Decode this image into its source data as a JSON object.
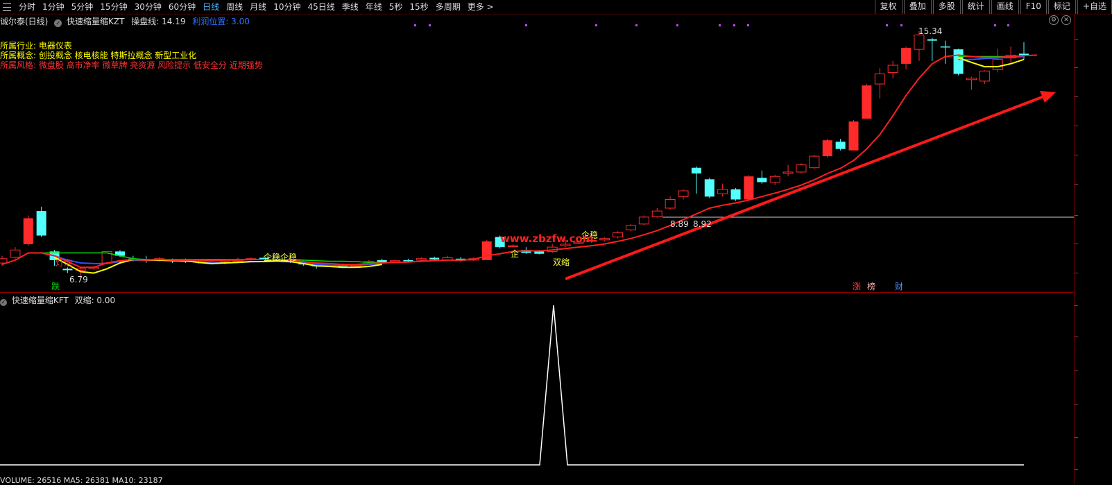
{
  "toolbar": {
    "periods": [
      "分时",
      "1分钟",
      "5分钟",
      "15分钟",
      "30分钟",
      "60分钟",
      "日线",
      "周线",
      "月线",
      "10分钟",
      "45日线",
      "季线",
      "年线",
      "5秒",
      "15秒",
      "多周期",
      "更多 >"
    ],
    "active_index": 6,
    "right_buttons": [
      "复权",
      "叠加",
      "多股",
      "统计",
      "画线",
      "F10",
      "标记",
      "+自选"
    ]
  },
  "main_panel": {
    "title": "诚尔泰(日线)",
    "indicator_name": "快速缩量缩KZT",
    "line1_label": "操盘线: 14.19",
    "line2_label": "利润位置: 3.00",
    "industry": "所属行业: 电器仪表",
    "concepts": "所属概念: 创投概念 核电核能 特斯拉概念 新型工业化",
    "style": "所属风格: 微盘股 高市净率 微草牌 亮资源 风险提示 低安全分 近期强势",
    "high_label": "15.34",
    "low_label": "6.79",
    "mark_889": "8.89",
    "mark_892": "8.92",
    "watermark": "www.zbzfw.com",
    "signal_dengpao": "灯泡",
    "signal_die": "跌",
    "signal_qiwen1": "企稳企稳",
    "signal_qiwen2": "企稳",
    "signal_qi": "企",
    "signal_shuangsuo": "双缩",
    "tag_zhang": "涨",
    "tag_bang": "榜",
    "tag_cai": "财",
    "colors": {
      "up": "#ff2a2a",
      "down": "#54ffff",
      "ma_red": "#ff2020",
      "ma_yellow": "#ffff00",
      "ma_green": "#00e000",
      "ma_blue": "#3050ff",
      "background": "#000000"
    }
  },
  "sub_panel": {
    "indicator_name": "快速缩量缩KFT",
    "value_label": "双缩: 0.00"
  },
  "footer": {
    "volume_text": "VOLUME: 26516  MA5: 26381  MA10: 23187"
  },
  "chart_data": {
    "type": "candlestick",
    "title": "诚尔泰(日线)",
    "candles": [
      {
        "o": 7.3,
        "c": 7.45,
        "h": 7.55,
        "l": 7.2,
        "dir": "up"
      },
      {
        "o": 7.5,
        "c": 7.75,
        "h": 7.85,
        "l": 7.45,
        "dir": "up"
      },
      {
        "o": 7.95,
        "c": 8.85,
        "h": 8.95,
        "l": 7.9,
        "dir": "up"
      },
      {
        "o": 9.1,
        "c": 8.25,
        "h": 9.25,
        "l": 8.2,
        "dir": "down"
      },
      {
        "o": 7.7,
        "c": 7.4,
        "h": 7.75,
        "l": 7.2,
        "dir": "down"
      },
      {
        "o": 7.1,
        "c": 7.05,
        "h": 7.15,
        "l": 6.95,
        "dir": "down"
      },
      {
        "o": 7.05,
        "c": 7.1,
        "h": 7.15,
        "l": 6.79,
        "dir": "up"
      },
      {
        "o": 7.1,
        "c": 7.15,
        "h": 7.2,
        "l": 7.05,
        "dir": "up"
      },
      {
        "o": 7.3,
        "c": 7.7,
        "h": 7.72,
        "l": 7.25,
        "dir": "up"
      },
      {
        "o": 7.7,
        "c": 7.55,
        "h": 7.75,
        "l": 7.5,
        "dir": "down"
      },
      {
        "o": 7.45,
        "c": 7.4,
        "h": 7.55,
        "l": 7.35,
        "dir": "down"
      },
      {
        "o": 7.42,
        "c": 7.4,
        "h": 7.55,
        "l": 7.3,
        "dir": "down"
      },
      {
        "o": 7.38,
        "c": 7.45,
        "h": 7.5,
        "l": 7.35,
        "dir": "up"
      },
      {
        "o": 7.4,
        "c": 7.38,
        "h": 7.45,
        "l": 7.3,
        "dir": "down"
      },
      {
        "o": 7.38,
        "c": 7.38,
        "h": 7.45,
        "l": 7.3,
        "dir": "down"
      },
      {
        "o": 7.36,
        "c": 7.32,
        "h": 7.4,
        "l": 7.28,
        "dir": "down"
      },
      {
        "o": 7.3,
        "c": 7.28,
        "h": 7.35,
        "l": 7.25,
        "dir": "down"
      },
      {
        "o": 7.3,
        "c": 7.35,
        "h": 7.4,
        "l": 7.25,
        "dir": "up"
      },
      {
        "o": 7.38,
        "c": 7.4,
        "h": 7.48,
        "l": 7.35,
        "dir": "up"
      },
      {
        "o": 7.42,
        "c": 7.45,
        "h": 7.5,
        "l": 7.38,
        "dir": "up"
      },
      {
        "o": 7.48,
        "c": 7.42,
        "h": 7.52,
        "l": 7.38,
        "dir": "down"
      },
      {
        "o": 7.45,
        "c": 7.4,
        "h": 7.55,
        "l": 7.35,
        "dir": "down"
      },
      {
        "o": 7.4,
        "c": 7.38,
        "h": 7.45,
        "l": 7.3,
        "dir": "down"
      },
      {
        "o": 7.35,
        "c": 7.25,
        "h": 7.38,
        "l": 7.2,
        "dir": "down"
      },
      {
        "o": 7.22,
        "c": 7.2,
        "h": 7.28,
        "l": 7.1,
        "dir": "down"
      },
      {
        "o": 7.2,
        "c": 7.22,
        "h": 7.28,
        "l": 7.15,
        "dir": "up"
      },
      {
        "o": 7.22,
        "c": 7.18,
        "h": 7.28,
        "l": 7.12,
        "dir": "down"
      },
      {
        "o": 7.2,
        "c": 7.22,
        "h": 7.25,
        "l": 7.15,
        "dir": "up"
      },
      {
        "o": 7.25,
        "c": 7.35,
        "h": 7.4,
        "l": 7.22,
        "dir": "up"
      },
      {
        "o": 7.4,
        "c": 7.32,
        "h": 7.45,
        "l": 7.3,
        "dir": "down"
      },
      {
        "o": 7.35,
        "c": 7.38,
        "h": 7.42,
        "l": 7.3,
        "dir": "up"
      },
      {
        "o": 7.4,
        "c": 7.36,
        "h": 7.45,
        "l": 7.32,
        "dir": "down"
      },
      {
        "o": 7.4,
        "c": 7.45,
        "h": 7.5,
        "l": 7.35,
        "dir": "up"
      },
      {
        "o": 7.48,
        "c": 7.42,
        "h": 7.52,
        "l": 7.38,
        "dir": "down"
      },
      {
        "o": 7.4,
        "c": 7.48,
        "h": 7.55,
        "l": 7.38,
        "dir": "up"
      },
      {
        "o": 7.45,
        "c": 7.38,
        "h": 7.5,
        "l": 7.35,
        "dir": "down"
      },
      {
        "o": 7.4,
        "c": 7.45,
        "h": 7.5,
        "l": 7.38,
        "dir": "up"
      },
      {
        "o": 7.4,
        "c": 8.05,
        "h": 8.1,
        "l": 7.4,
        "dir": "up"
      },
      {
        "o": 8.2,
        "c": 7.85,
        "h": 8.25,
        "l": 7.8,
        "dir": "down"
      },
      {
        "o": 7.88,
        "c": 7.9,
        "h": 7.95,
        "l": 7.85,
        "dir": "up"
      },
      {
        "o": 7.75,
        "c": 7.65,
        "h": 7.85,
        "l": 7.62,
        "dir": "down"
      },
      {
        "o": 7.7,
        "c": 7.62,
        "h": 7.75,
        "l": 7.6,
        "dir": "down"
      },
      {
        "o": 7.7,
        "c": 7.85,
        "h": 7.95,
        "l": 7.65,
        "dir": "up"
      },
      {
        "o": 7.9,
        "c": 7.95,
        "h": 8.1,
        "l": 7.85,
        "dir": "up"
      },
      {
        "o": 8.0,
        "c": 8.02,
        "h": 8.08,
        "l": 7.95,
        "dir": "up"
      },
      {
        "o": 8.05,
        "c": 8.08,
        "h": 8.12,
        "l": 8.0,
        "dir": "up"
      },
      {
        "o": 8.1,
        "c": 8.15,
        "h": 8.2,
        "l": 8.05,
        "dir": "up"
      },
      {
        "o": 8.2,
        "c": 8.35,
        "h": 8.4,
        "l": 8.15,
        "dir": "up"
      },
      {
        "o": 8.45,
        "c": 8.6,
        "h": 8.65,
        "l": 8.4,
        "dir": "up"
      },
      {
        "o": 8.65,
        "c": 8.89,
        "h": 8.95,
        "l": 8.6,
        "dir": "up"
      },
      {
        "o": 8.9,
        "c": 9.1,
        "h": 9.2,
        "l": 8.85,
        "dir": "up"
      },
      {
        "o": 9.2,
        "c": 9.5,
        "h": 9.6,
        "l": 9.15,
        "dir": "up"
      },
      {
        "o": 9.6,
        "c": 9.8,
        "h": 9.85,
        "l": 9.5,
        "dir": "up"
      },
      {
        "o": 10.6,
        "c": 10.4,
        "h": 10.65,
        "l": 9.7,
        "dir": "down"
      },
      {
        "o": 10.2,
        "c": 9.6,
        "h": 10.25,
        "l": 9.55,
        "dir": "down"
      },
      {
        "o": 9.7,
        "c": 9.85,
        "h": 10.05,
        "l": 9.6,
        "dir": "up"
      },
      {
        "o": 9.85,
        "c": 9.5,
        "h": 9.9,
        "l": 9.45,
        "dir": "down"
      },
      {
        "o": 9.5,
        "c": 10.3,
        "h": 10.35,
        "l": 9.5,
        "dir": "up"
      },
      {
        "o": 10.25,
        "c": 10.1,
        "h": 10.5,
        "l": 10.05,
        "dir": "down"
      },
      {
        "o": 10.1,
        "c": 10.3,
        "h": 10.35,
        "l": 10.0,
        "dir": "up"
      },
      {
        "o": 10.4,
        "c": 10.45,
        "h": 10.7,
        "l": 10.3,
        "dir": "up"
      },
      {
        "o": 10.45,
        "c": 10.7,
        "h": 10.75,
        "l": 10.4,
        "dir": "up"
      },
      {
        "o": 10.6,
        "c": 11.0,
        "h": 11.05,
        "l": 10.55,
        "dir": "up"
      },
      {
        "o": 11.0,
        "c": 11.55,
        "h": 11.6,
        "l": 10.95,
        "dir": "up"
      },
      {
        "o": 11.5,
        "c": 11.25,
        "h": 11.6,
        "l": 11.2,
        "dir": "down"
      },
      {
        "o": 11.2,
        "c": 12.2,
        "h": 12.25,
        "l": 11.2,
        "dir": "up"
      },
      {
        "o": 12.3,
        "c": 13.45,
        "h": 13.5,
        "l": 12.3,
        "dir": "up"
      },
      {
        "o": 13.5,
        "c": 13.85,
        "h": 14.05,
        "l": 13.0,
        "dir": "up"
      },
      {
        "o": 13.9,
        "c": 14.15,
        "h": 14.3,
        "l": 13.7,
        "dir": "up"
      },
      {
        "o": 14.2,
        "c": 14.75,
        "h": 14.8,
        "l": 14.0,
        "dir": "up"
      },
      {
        "o": 14.7,
        "c": 15.2,
        "h": 15.34,
        "l": 14.3,
        "dir": "up"
      },
      {
        "o": 15.05,
        "c": 15.0,
        "h": 15.1,
        "l": 14.3,
        "dir": "down"
      },
      {
        "o": 14.8,
        "c": 14.8,
        "h": 15.0,
        "l": 14.2,
        "dir": "down"
      },
      {
        "o": 14.7,
        "c": 13.85,
        "h": 14.72,
        "l": 13.8,
        "dir": "down"
      },
      {
        "o": 13.65,
        "c": 13.7,
        "h": 13.75,
        "l": 13.3,
        "dir": "up"
      },
      {
        "o": 13.6,
        "c": 13.95,
        "h": 13.98,
        "l": 13.5,
        "dir": "up"
      },
      {
        "o": 14.0,
        "c": 14.35,
        "h": 14.72,
        "l": 13.9,
        "dir": "up"
      },
      {
        "o": 14.4,
        "c": 14.5,
        "h": 14.8,
        "l": 14.2,
        "dir": "up"
      },
      {
        "o": 14.5,
        "c": 14.55,
        "h": 14.95,
        "l": 14.35,
        "dir": "down"
      }
    ],
    "red_line": [
      7.25,
      7.4,
      7.65,
      7.65,
      7.55,
      7.35,
      7.15,
      7.15,
      7.3,
      7.38,
      7.42,
      7.4,
      7.42,
      7.4,
      7.4,
      7.4,
      7.38,
      7.4,
      7.4,
      7.42,
      7.42,
      7.42,
      7.4,
      7.35,
      7.3,
      7.28,
      7.25,
      7.25,
      7.28,
      7.3,
      7.32,
      7.33,
      7.36,
      7.38,
      7.4,
      7.4,
      7.42,
      7.55,
      7.62,
      7.7,
      7.72,
      7.72,
      7.75,
      7.8,
      7.85,
      7.9,
      7.96,
      8.05,
      8.15,
      8.28,
      8.42,
      8.6,
      8.8,
      9.0,
      9.2,
      9.3,
      9.38,
      9.48,
      9.6,
      9.72,
      9.85,
      10.0,
      10.18,
      10.4,
      10.58,
      10.85,
      11.25,
      11.75,
      12.4,
      13.1,
      13.7,
      14.2,
      14.45,
      14.5,
      14.45,
      14.42,
      14.42,
      14.45,
      14.48,
      14.5
    ],
    "yellow_line": [
      null,
      null,
      null,
      null,
      7.5,
      7.25,
      7.0,
      6.95,
      7.1,
      7.3,
      7.42,
      7.4,
      7.4,
      7.38,
      7.38,
      7.32,
      7.28,
      7.3,
      7.32,
      7.35,
      7.35,
      7.38,
      7.35,
      7.28,
      7.2,
      7.18,
      7.15,
      7.15,
      7.18,
      7.25
    ],
    "green_line": [
      null,
      null,
      null,
      7.65,
      7.65,
      7.65,
      7.65,
      7.65,
      7.65,
      7.55,
      7.45,
      7.42,
      7.42,
      7.42,
      7.42,
      7.42,
      7.42,
      7.42,
      7.42,
      7.42,
      7.42,
      7.42,
      7.42,
      7.4,
      7.38,
      7.36,
      7.36,
      7.35,
      7.32,
      7.32
    ],
    "blue_line": [
      null,
      null,
      null,
      7.65,
      7.55,
      7.4,
      7.3,
      7.28,
      7.28,
      7.35,
      7.4,
      7.4,
      7.4,
      7.38,
      7.38,
      7.35,
      7.32,
      7.32,
      7.32,
      7.34,
      7.35,
      7.35,
      7.34,
      7.3,
      7.25,
      7.22,
      7.22,
      7.22,
      7.25,
      7.28
    ],
    "late_yellow": [
      14.4,
      14.25,
      14.1,
      14.1,
      14.2,
      14.35
    ],
    "late_green": [
      14.45,
      14.45,
      14.45,
      14.45,
      14.45,
      14.45
    ],
    "late_blue": [
      14.35,
      14.35,
      14.38,
      14.4,
      14.42,
      14.45
    ],
    "sub_indicator": {
      "name": "双缩",
      "peak_index": 40,
      "peak_value": 1,
      "baseline": 0
    }
  }
}
